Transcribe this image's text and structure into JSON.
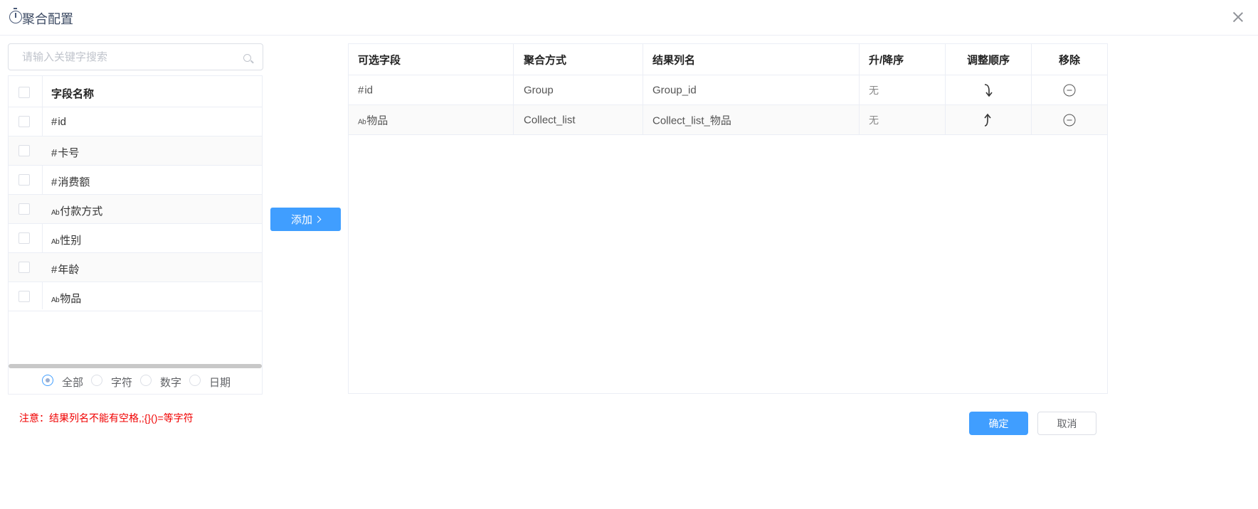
{
  "dialog": {
    "title": "聚合配置"
  },
  "search": {
    "placeholder": "请输入关键字搜索"
  },
  "field_list": {
    "header": "字段名称",
    "items": [
      {
        "type": "#",
        "name": "id"
      },
      {
        "type": "#",
        "name": "卡号"
      },
      {
        "type": "#",
        "name": "消费额"
      },
      {
        "type": "Ab",
        "name": "付款方式"
      },
      {
        "type": "Ab",
        "name": "性别"
      },
      {
        "type": "#",
        "name": "年龄"
      },
      {
        "type": "Ab",
        "name": "物品"
      }
    ]
  },
  "type_filter": {
    "options": [
      "全部",
      "字符",
      "数字",
      "日期"
    ],
    "selected": "全部"
  },
  "add_button": {
    "label": "添加"
  },
  "result_table": {
    "headers": [
      "可选字段",
      "聚合方式",
      "结果列名",
      "升/降序",
      "调整顺序",
      "移除"
    ],
    "rows": [
      {
        "field_type": "#",
        "field": "id",
        "method": "Group",
        "result_name": "Group_id",
        "order": "无",
        "move": "move-down-icon"
      },
      {
        "field_type": "Ab",
        "field": "物品",
        "method": "Collect_list",
        "result_name": "Collect_list_物品",
        "order": "无",
        "move": "move-up-icon"
      }
    ]
  },
  "footer": {
    "note": "注意：结果列名不能有空格,;{}()=等字符",
    "confirm_label": "确定",
    "cancel_label": "取消"
  },
  "colors": {
    "primary": "#409eff",
    "warning_text": "#f00000",
    "border": "#ebeef5"
  }
}
